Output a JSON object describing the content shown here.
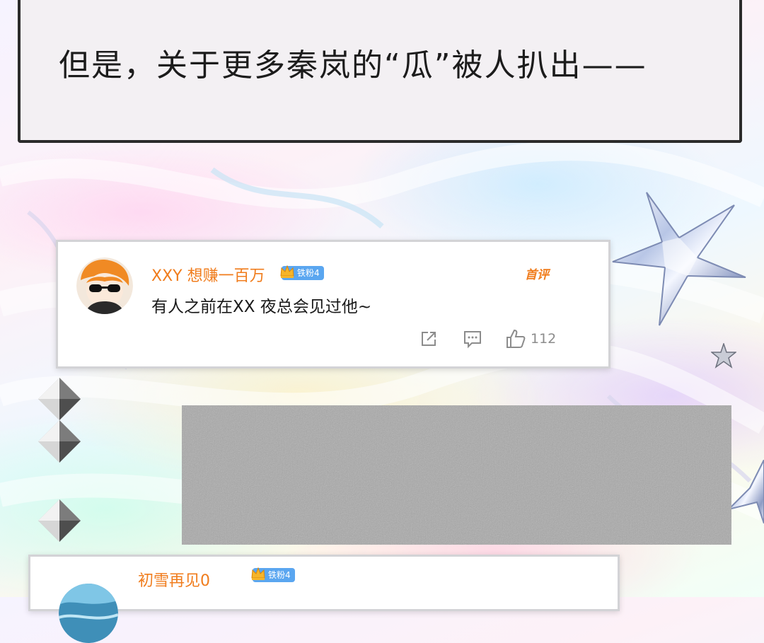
{
  "caption": {
    "text": "但是，关于更多秦岚的“瓜”被人扒出——"
  },
  "comments": [
    {
      "username": "XXY 想赚一百万",
      "fan_badge": "铁粉4",
      "pin_label": "首评",
      "body": "有人之前在XX 夜总会见过他~",
      "like_count": "112",
      "avatar": "cartoon-avatar-sunglasses"
    },
    {
      "username": "初雪再见0",
      "fan_badge": "铁粉4",
      "avatar": "ocean-avatar"
    }
  ],
  "redacted_block": {
    "color": "#a9a9a9"
  },
  "icons": {
    "share": "share-icon",
    "comment": "comment-icon",
    "like": "thumbs-up-icon"
  },
  "colors": {
    "username": "#f07c1c",
    "badge": "#5aa6f0",
    "caption_border": "#2b2b2b"
  }
}
